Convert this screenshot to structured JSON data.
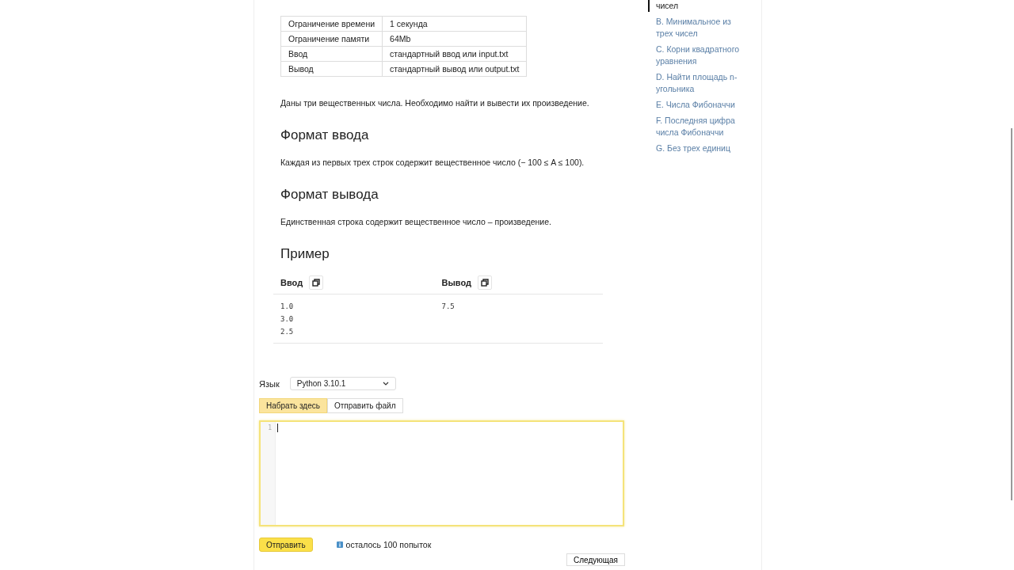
{
  "limits": [
    {
      "label": "Ограничение времени",
      "value": "1 секунда"
    },
    {
      "label": "Ограничение памяти",
      "value": "64Mb"
    },
    {
      "label": "Ввод",
      "value": "стандартный ввод или input.txt"
    },
    {
      "label": "Вывод",
      "value": "стандартный вывод или output.txt"
    }
  ],
  "statement": "Даны три вещественных числа. Необходимо найти и вывести их произведение.",
  "sections": [
    {
      "title": "Формат ввода",
      "text": "Каждая из первых трех строк содержит вещественное число (− 100 ≤ A ≤ 100)."
    },
    {
      "title": "Формат вывода",
      "text": "Единственная строка содержит вещественное число – произведение."
    }
  ],
  "example": {
    "title": "Пример",
    "input_label": "Ввод",
    "output_label": "Вывод",
    "input_lines": [
      "1.0",
      "3.0",
      "2.5"
    ],
    "output_lines": [
      "7.5"
    ]
  },
  "language": {
    "label": "Язык",
    "value": "Python 3.10.1"
  },
  "editor_tabs": [
    {
      "label": "Набрать здесь",
      "selected": true
    },
    {
      "label": "Отправить файл",
      "selected": false
    }
  ],
  "editor": {
    "line_numbers": [
      "1"
    ]
  },
  "submit": "Отправить",
  "attempts": "осталось 100 попыток",
  "next": "Следующая",
  "sidebar": {
    "items": [
      {
        "label": "чисел",
        "selected": true
      },
      {
        "label": "B. Минимальное из трех чисел",
        "selected": false
      },
      {
        "label": "C. Корни квадратного уравнения",
        "selected": false
      },
      {
        "label": "D. Найти площадь n-угольника",
        "selected": false
      },
      {
        "label": "E. Числа Фибоначчи",
        "selected": false
      },
      {
        "label": "F. Последняя цифра числа Фибоначчи",
        "selected": false
      },
      {
        "label": "G. Без трех единиц",
        "selected": false
      }
    ]
  }
}
